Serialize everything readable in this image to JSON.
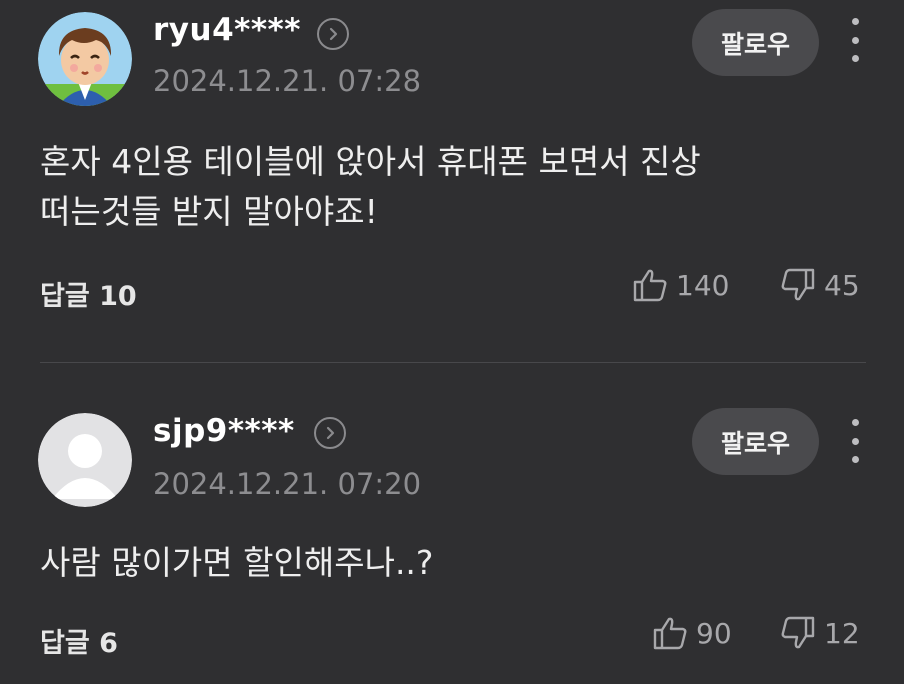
{
  "comments": [
    {
      "username": "ryu4****",
      "timestamp": "2024.12.21. 07:28",
      "follow_label": "팔로우",
      "text_lines": [
        "혼자 4인용 테이블에 앉아서 휴대폰 보면서 진상",
        "떠는것들 받지 말아야죠!"
      ],
      "reply_label": "답글 10",
      "likes": "140",
      "dislikes": "45",
      "avatar": "cartoon-avatar-icon"
    },
    {
      "username": "sjp9****",
      "timestamp": "2024.12.21. 07:20",
      "follow_label": "팔로우",
      "text_lines": [
        "사람 많이가면 할인해주나..?"
      ],
      "reply_label": "답글 6",
      "likes": "90",
      "dislikes": "12",
      "avatar": "default-user-icon"
    }
  ],
  "colors": {
    "background": "#2f2f31",
    "follow_button": "#4a4a4d",
    "timestamp": "#8d8d90",
    "divider": "#48484b"
  }
}
